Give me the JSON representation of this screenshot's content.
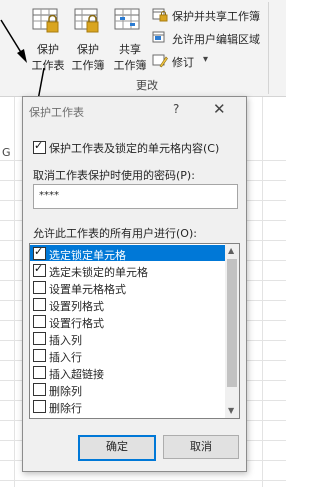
{
  "ribbon": {
    "buttons": [
      {
        "line1": "保护",
        "line2": "工作表"
      },
      {
        "line1": "保护",
        "line2": "工作簿"
      },
      {
        "line1": "共享",
        "line2": "工作簿"
      }
    ],
    "small_buttons": [
      {
        "label": "保护并共享工作簿"
      },
      {
        "label": "允许用户编辑区域"
      },
      {
        "label": "修订",
        "dropdown": "▾"
      }
    ],
    "group_label": "更改"
  },
  "sheet": {
    "column_label": "G"
  },
  "dialog": {
    "title": "保护工作表",
    "help_glyph": "?",
    "close_glyph": "✕",
    "protect_option": {
      "label": "保护工作表及锁定的单元格内容(C)",
      "checked": true
    },
    "password_label": "取消工作表保护时使用的密码(P):",
    "password_value": "****",
    "list_label": "允许此工作表的所有用户进行(O):",
    "permissions": [
      {
        "label": "选定锁定单元格",
        "checked": true,
        "selected": true
      },
      {
        "label": "选定未锁定的单元格",
        "checked": true,
        "selected": false
      },
      {
        "label": "设置单元格格式",
        "checked": false,
        "selected": false
      },
      {
        "label": "设置列格式",
        "checked": false,
        "selected": false
      },
      {
        "label": "设置行格式",
        "checked": false,
        "selected": false
      },
      {
        "label": "插入列",
        "checked": false,
        "selected": false
      },
      {
        "label": "插入行",
        "checked": false,
        "selected": false
      },
      {
        "label": "插入超链接",
        "checked": false,
        "selected": false
      },
      {
        "label": "删除列",
        "checked": false,
        "selected": false
      },
      {
        "label": "删除行",
        "checked": false,
        "selected": false
      }
    ],
    "ok_label": "确定",
    "cancel_label": "取消"
  },
  "colors": {
    "selection": "#0078d7",
    "ribbon_bg": "#f3f3f3",
    "dialog_bg": "#f0f0f0",
    "lock_gold": "#d9a520"
  }
}
